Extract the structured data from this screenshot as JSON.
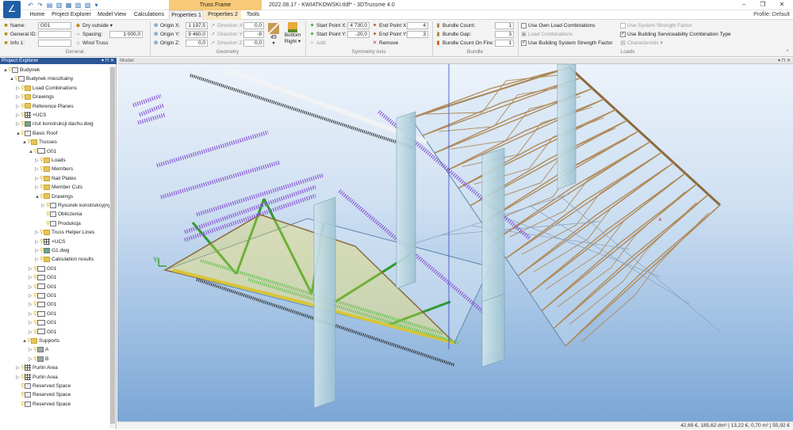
{
  "titlebar": {
    "context_tab": "Truss Frame",
    "window_title": "2022.08.17 - KWIATKOWSKI.tldf* - 3DTrussme 4.0",
    "controls": [
      "–",
      "❐",
      "✕"
    ]
  },
  "tabs": [
    "Home",
    "Project Explorer",
    "Model View",
    "Calculations",
    "Properties 1",
    "Properties 2",
    "Tools"
  ],
  "profile": "Profile: Default",
  "ribbon": {
    "general": {
      "name_label": "Name:",
      "name_value": "G01",
      "general_id_label": "General ID:",
      "general_id_value": "",
      "info_label": "Info 1:",
      "info_value": "",
      "dry_outside": "Dry outside",
      "spacing_label": "Spacing:",
      "spacing_value": "1 000,0",
      "wind_truss": "Wind Truss",
      "group_label": "General"
    },
    "geometry": {
      "origin_x_label": "Origin X:",
      "origin_x": "1 197,5",
      "origin_y_label": "Origin Y:",
      "origin_y": "9 460,0",
      "origin_z_label": "Origin Z:",
      "origin_z": "0,0",
      "dir_x_label": "Direction X:",
      "dir_x": "0,0",
      "dir_y_label": "Direction Y:",
      "dir_y": "-9 460,0",
      "dir_z_label": "Direction Z:",
      "dir_z": "0,0",
      "angle": "45",
      "bottom_right_1": "Bottom",
      "bottom_right_2": "Right",
      "group_label": "Geometry"
    },
    "symmetry": {
      "start_x_label": "Start Point X:",
      "start_x": "4 730,0",
      "start_y_label": "Start Point Y:",
      "start_y": "-20,0",
      "end_x_label": "End Point X:",
      "end_x": "4 730,0",
      "end_y_label": "End Point Y:",
      "end_y": "3 106,0",
      "add": "Add",
      "remove": "Remove",
      "group_label": "Symmetry Axis"
    },
    "bundle": {
      "count_label": "Bundle Count:",
      "count": "1",
      "gap_label": "Bundle Gap:",
      "gap": "3",
      "fire_label": "Bundle Count On Fire:",
      "fire": "1",
      "group_label": "Bundle"
    },
    "loads": {
      "own_load": "Use Own Load Combinations",
      "load_combinations": "Load Combinations",
      "system_strength": "Use Building System Strength Factor",
      "system_strength_factor": "Use System Strength Factor",
      "serviceability": "Use Building Serviceability Combination Type",
      "characteristic": "Characteristic",
      "group_label": "Loads"
    }
  },
  "explorer": {
    "title": "Project Explorer",
    "items": [
      {
        "label": "Budynek",
        "depth": 0,
        "icon": "building",
        "arrow": "▲"
      },
      {
        "label": "Budynek mieszkalny",
        "depth": 1,
        "icon": "house",
        "arrow": "▲"
      },
      {
        "label": "Load Combinations",
        "depth": 2,
        "icon": "folder",
        "arrow": "▷"
      },
      {
        "label": "Drawings",
        "depth": 2,
        "icon": "folder",
        "arrow": "▷"
      },
      {
        "label": "Reference Planes",
        "depth": 2,
        "icon": "folder",
        "arrow": "▷"
      },
      {
        "label": "+UCS",
        "depth": 2,
        "icon": "grid",
        "arrow": "▷"
      },
      {
        "label": "rzut konstrukcji dachu.dwg",
        "depth": 2,
        "icon": "dwg",
        "arrow": "▷"
      },
      {
        "label": "Basic Roof",
        "depth": 2,
        "icon": "roof",
        "arrow": "▲"
      },
      {
        "label": "Trusses",
        "depth": 3,
        "icon": "folder",
        "arrow": "▲"
      },
      {
        "label": "G01",
        "depth": 4,
        "icon": "truss",
        "arrow": "▲"
      },
      {
        "label": "Loads",
        "depth": 5,
        "icon": "folder",
        "arrow": "▷"
      },
      {
        "label": "Members",
        "depth": 5,
        "icon": "folder",
        "arrow": "▷"
      },
      {
        "label": "Nail Plates",
        "depth": 5,
        "icon": "folder",
        "arrow": "▷"
      },
      {
        "label": "Member Cuts",
        "depth": 5,
        "icon": "folder",
        "arrow": "▷"
      },
      {
        "label": "Drawings",
        "depth": 5,
        "icon": "folder",
        "arrow": "▲"
      },
      {
        "label": "Rysunek konstrukcyjny",
        "depth": 6,
        "icon": "drawing",
        "arrow": "▷"
      },
      {
        "label": "Obliczenia",
        "depth": 6,
        "icon": "drawing",
        "arrow": ""
      },
      {
        "label": "Produkcja",
        "depth": 6,
        "icon": "drawing",
        "arrow": ""
      },
      {
        "label": "Truss Helper Lines",
        "depth": 5,
        "icon": "folder",
        "arrow": "▷"
      },
      {
        "label": "+UCS",
        "depth": 5,
        "icon": "grid",
        "arrow": "▷"
      },
      {
        "label": "G1.dwg",
        "depth": 5,
        "icon": "dwg",
        "arrow": "▷"
      },
      {
        "label": "Calculation results",
        "depth": 5,
        "icon": "folder",
        "arrow": "▷"
      },
      {
        "label": "G01",
        "depth": 4,
        "icon": "truss",
        "arrow": "▷"
      },
      {
        "label": "G01",
        "depth": 4,
        "icon": "truss",
        "arrow": "▷"
      },
      {
        "label": "G01",
        "depth": 4,
        "icon": "truss",
        "arrow": "▷"
      },
      {
        "label": "G01",
        "depth": 4,
        "icon": "truss",
        "arrow": "▷"
      },
      {
        "label": "G01",
        "depth": 4,
        "icon": "truss",
        "arrow": "▷"
      },
      {
        "label": "G01",
        "depth": 4,
        "icon": "truss",
        "arrow": "▷"
      },
      {
        "label": "G01",
        "depth": 4,
        "icon": "truss",
        "arrow": "▷"
      },
      {
        "label": "G01",
        "depth": 4,
        "icon": "truss",
        "arrow": "▷"
      },
      {
        "label": "Supports",
        "depth": 3,
        "icon": "folder",
        "arrow": "▲"
      },
      {
        "label": "A",
        "depth": 4,
        "icon": "support",
        "arrow": "▷"
      },
      {
        "label": "B",
        "depth": 4,
        "icon": "support",
        "arrow": "▷"
      },
      {
        "label": "Purlin Area",
        "depth": 2,
        "icon": "grid",
        "arrow": "▷"
      },
      {
        "label": "Purlin Area",
        "depth": 2,
        "icon": "grid",
        "arrow": "▷"
      },
      {
        "label": "Reserved Space",
        "depth": 2,
        "icon": "bulb",
        "arrow": ""
      },
      {
        "label": "Reserved Space",
        "depth": 2,
        "icon": "bulb",
        "arrow": ""
      },
      {
        "label": "Reserved Space",
        "depth": 2,
        "icon": "bulb",
        "arrow": ""
      }
    ]
  },
  "model": {
    "title": "Model",
    "axis_y_label": "Y"
  },
  "status": "42,69 €, 185,62 dm³ | 13,22 €, 0,70 m² | 55,92 €",
  "colors": {
    "accent": "#2b5797",
    "context_tab": "#f7c978",
    "timber": "#b08a5a",
    "green_member": "#2f9b2f",
    "purlin": "#8a5bd6"
  }
}
